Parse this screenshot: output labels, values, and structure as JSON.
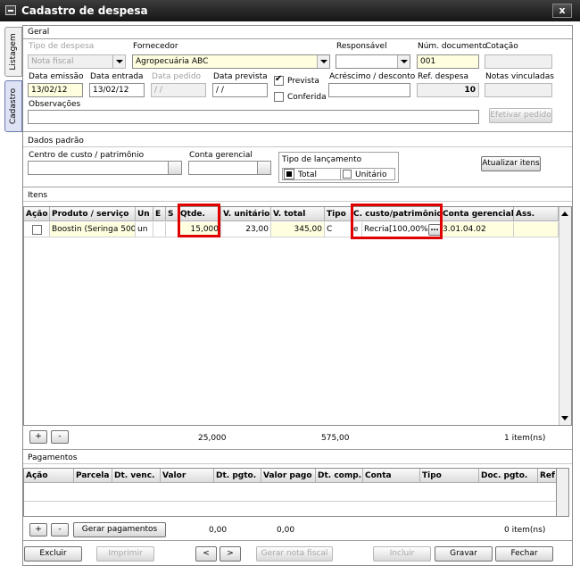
{
  "window": {
    "title": "Cadastro de despesa",
    "close_label": "x"
  },
  "side_tabs": {
    "listagem": "Listagem",
    "cadastro": "Cadastro"
  },
  "geral": {
    "section_title": "Geral",
    "tipo_despesa": {
      "label": "Tipo de despesa",
      "value": "Nota fiscal"
    },
    "fornecedor": {
      "label": "Fornecedor",
      "value": "Agropecuária ABC"
    },
    "responsavel": {
      "label": "Responsável",
      "value": ""
    },
    "num_documento": {
      "label": "Núm. documento",
      "value": "001"
    },
    "cotacao": {
      "label": "Cotação",
      "value": ""
    },
    "data_emissao": {
      "label": "Data emissão",
      "value": "13/02/12"
    },
    "data_entrada": {
      "label": "Data entrada",
      "value": "13/02/12"
    },
    "data_pedido": {
      "label": "Data pedido",
      "value": " / /"
    },
    "data_prevista": {
      "label": "Data prevista",
      "value": " / /"
    },
    "prevista": {
      "label": "Prevista",
      "checked": true
    },
    "conferida": {
      "label": "Conferida",
      "checked": false
    },
    "acrescimo_desconto": {
      "label": "Acréscimo / desconto",
      "value": ""
    },
    "ref_despesa": {
      "label": "Ref. despesa",
      "value": "10"
    },
    "notas_vinculadas": {
      "label": "Notas vinculadas",
      "value": ""
    },
    "observacoes": {
      "label": "Observações",
      "value": ""
    },
    "efetivar_pedido": "Efetivar pedido"
  },
  "dados_padrao": {
    "section_title": "Dados padrão",
    "centro_custo": {
      "label": "Centro de custo / patrimônio",
      "value": ""
    },
    "conta_gerencial": {
      "label": "Conta gerencial",
      "value": ""
    },
    "tipo_lancamento": {
      "label": "Tipo de lançamento",
      "total": "Total",
      "unitario": "Unitário",
      "selected": "Total"
    },
    "atualizar_itens": "Atualizar itens"
  },
  "itens": {
    "section_title": "Itens",
    "columns": [
      "Ação",
      "Produto / serviço",
      "Un",
      "E",
      "S",
      "Qtde.",
      "V. unitário",
      "V. total",
      "Tipo",
      "C. custo/patrimônio",
      "Conta gerencial",
      "Ass."
    ],
    "rows": [
      {
        "acao": "",
        "produto": "Boostin (Seringa 500 r",
        "un": "un",
        "e": "",
        "s": "",
        "qtde": "15,000",
        "v_unitario": "23,00",
        "v_total": "345,00",
        "tipo": "C",
        "ccusto_prefix": "e",
        "ccusto": "Recria[100,00%]",
        "conta_gerencial": "3.01.04.02",
        "ass": ""
      }
    ],
    "add_label": "+",
    "remove_label": "-",
    "total_qtde": "25,000",
    "total_valor": "575,00",
    "count_label": "1 item(ns)"
  },
  "pagamentos": {
    "section_title": "Pagamentos",
    "columns": [
      "Ação",
      "Parcela",
      "Dt. venc.",
      "Valor",
      "Dt. pgto.",
      "Valor pago",
      "Dt. comp.",
      "Conta",
      "Tipo",
      "Doc. pgto.",
      "Ref"
    ],
    "add_label": "+",
    "remove_label": "-",
    "gerar_pagamentos": "Gerar pagamentos",
    "total_valor": "0,00",
    "total_pago": "0,00",
    "count_label": "0 item(ns)"
  },
  "footer": {
    "excluir": "Excluir",
    "imprimir": "Imprimir",
    "prev": "<",
    "next": ">",
    "gerar_nota_fiscal": "Gerar nota fiscal",
    "incluir": "Incluir",
    "gravar": "Gravar",
    "fechar": "Fechar"
  },
  "colors": {
    "highlight": "#e00000",
    "field_yellow": "#ffffe0",
    "title_bar": "#1e1e1e"
  }
}
